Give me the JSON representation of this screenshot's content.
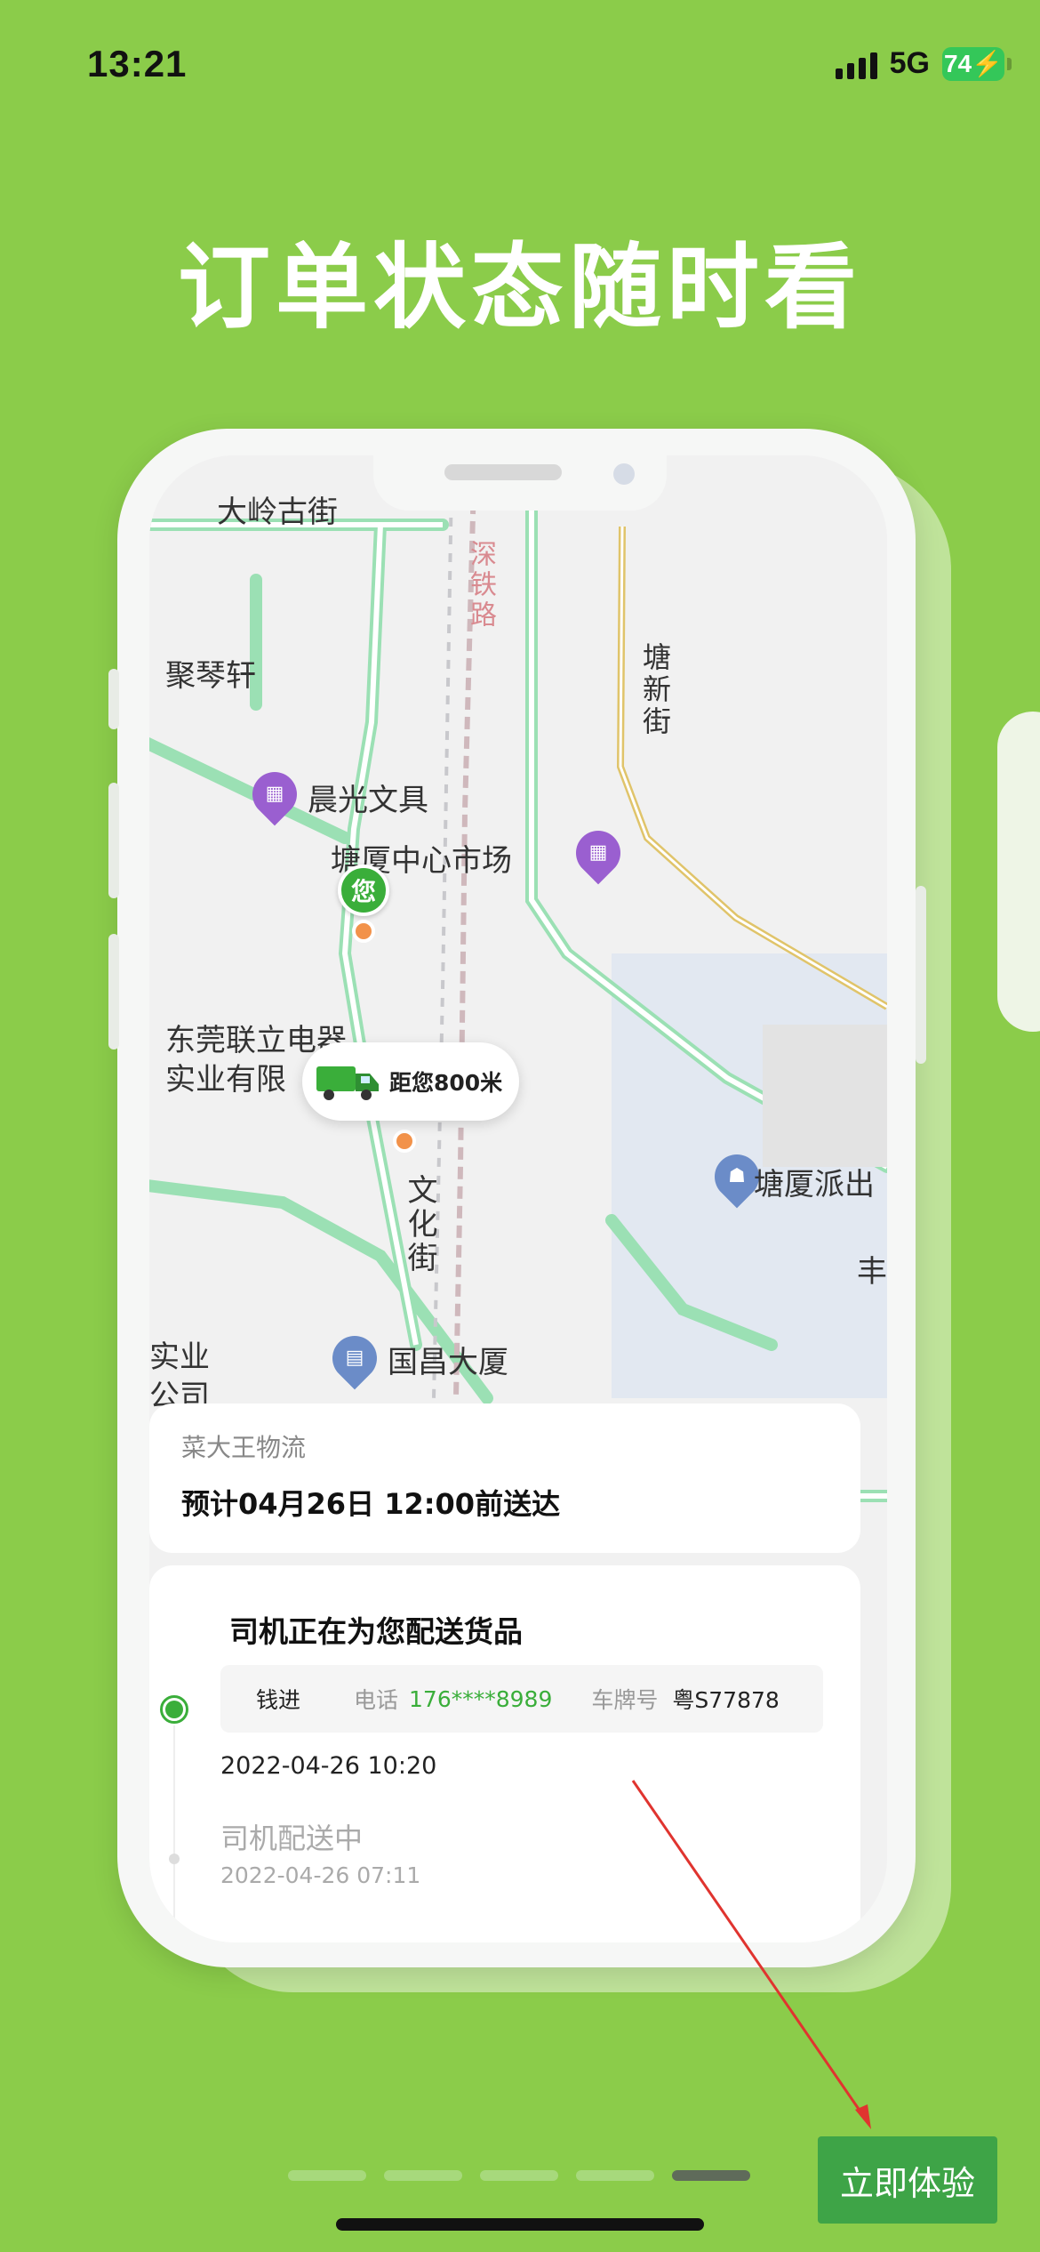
{
  "status_bar": {
    "time": "13:21",
    "network": "5G",
    "battery": "74"
  },
  "headline": "订单状态随时看",
  "map": {
    "labels": {
      "daling": "大岭古街",
      "shentie": "深铁路",
      "juqin": "聚琴轩",
      "tangxin": "塘新街",
      "chenguang": "晨光文具",
      "center_market": "塘厦中心市场",
      "dongguan_1": "东莞联立电器",
      "dongguan_2": "实业有限",
      "wenhua": "文化街",
      "police": "塘厦派出",
      "feng": "丰",
      "guochang": "国昌大厦",
      "shiye_1": "实业",
      "shiye_2": "公司"
    },
    "you_pin": "您",
    "truck_distance": "距您800米"
  },
  "order_card": {
    "carrier": "菜大王物流",
    "eta": "预计04月26日  12:00前送达"
  },
  "timeline": {
    "title": "司机正在为您配送货品",
    "driver_name": "钱进",
    "phone_label": "电话",
    "phone_value": "176****8989",
    "plate_label": "车牌号",
    "plate_value": "粤S77878",
    "time1": "2022-04-26  10:20",
    "step2": "司机配送中",
    "time2": "2022-04-26  07:11"
  },
  "pager": {
    "total": 5,
    "active": 5
  },
  "cta_label": "立即体验",
  "colors": {
    "background": "#8bcc4a",
    "accent": "#3ea447",
    "road": "#9be0b4",
    "arrow": "#e0342f"
  }
}
